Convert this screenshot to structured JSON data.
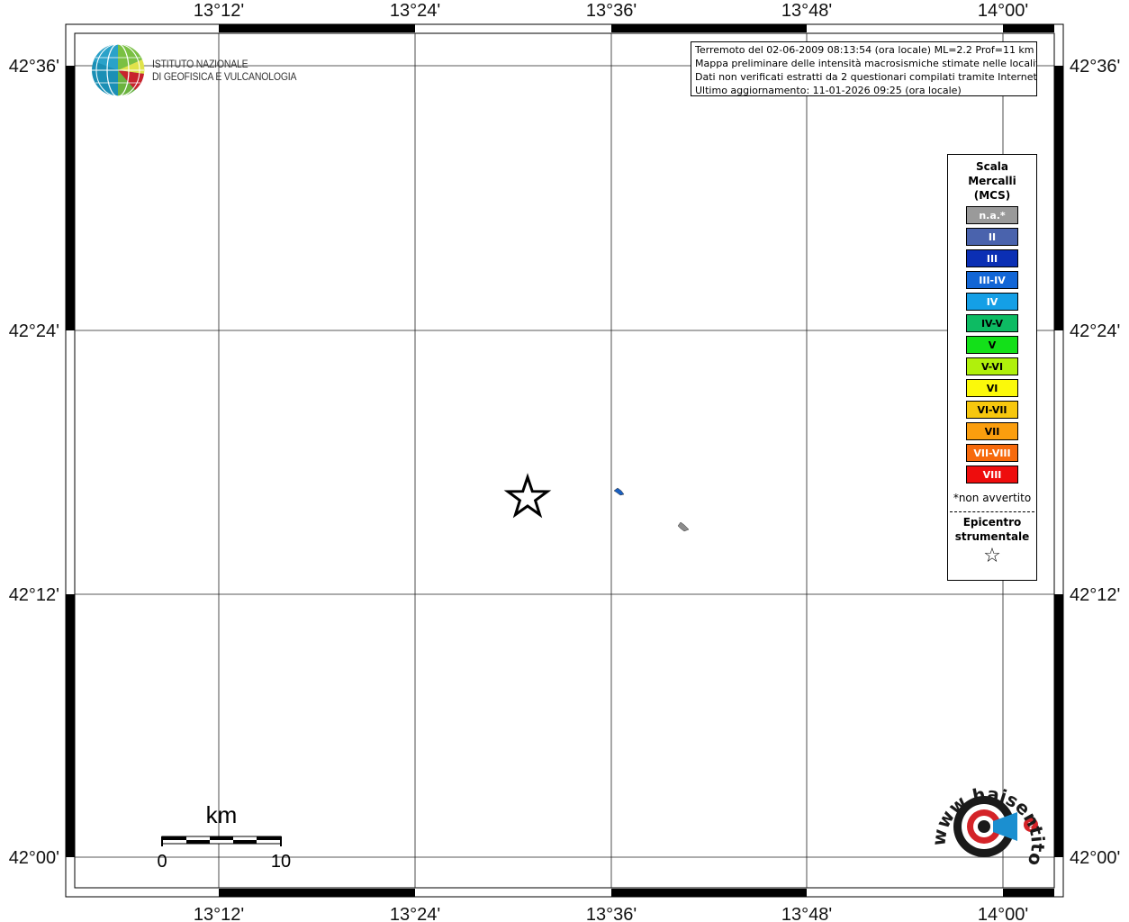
{
  "map": {
    "longitude_ticks": [
      "13°12'",
      "13°24'",
      "13°36'",
      "13°48'",
      "14°00'"
    ],
    "latitude_ticks": [
      "42°36'",
      "42°24'",
      "42°12'",
      "42°00'"
    ]
  },
  "institute": {
    "line1": "ISTITUTO NAZIONALE",
    "line2": "DI GEOFISICA E VULCANOLOGIA"
  },
  "info": {
    "line1": "Terremoto del 02-06-2009 08:13:54 (ora locale) ML=2.2 Prof=11 km",
    "line2": "Mappa preliminare delle intensità macrosismiche stimate nelle località",
    "line3": "Dati non verificati estratti da 2 questionari compilati tramite Internet.",
    "line4": "Ultimo aggiornamento: 11-01-2026 09:25 (ora locale)"
  },
  "legend": {
    "title1": "Scala",
    "title2": "Mercalli",
    "title3": "(MCS)",
    "items": [
      {
        "label": "n.a.*",
        "color": "#9a9a9a"
      },
      {
        "label": "II",
        "color": "#4a63ad"
      },
      {
        "label": "III",
        "color": "#0b2fb4"
      },
      {
        "label": "III-IV",
        "color": "#1266d6"
      },
      {
        "label": "IV",
        "color": "#149fe6"
      },
      {
        "label": "IV-V",
        "color": "#0dbb63"
      },
      {
        "label": "V",
        "color": "#13e019"
      },
      {
        "label": "V-VI",
        "color": "#b0f00c"
      },
      {
        "label": "VI",
        "color": "#fbf90a"
      },
      {
        "label": "VI-VII",
        "color": "#f7c70e"
      },
      {
        "label": "VII",
        "color": "#fb9e0e"
      },
      {
        "label": "VII-VIII",
        "color": "#f76a0c"
      },
      {
        "label": "VIII",
        "color": "#ee0d0d"
      }
    ],
    "note": "*non avvertito",
    "epicenter_line1": "Epicentro",
    "epicenter_line2": "strumentale",
    "epicenter_symbol": "☆"
  },
  "scale_bar": {
    "title": "km",
    "start_label": "0",
    "end_label": "10"
  },
  "watermark": {
    "text": "www.haisentitoilterremoto.it"
  }
}
